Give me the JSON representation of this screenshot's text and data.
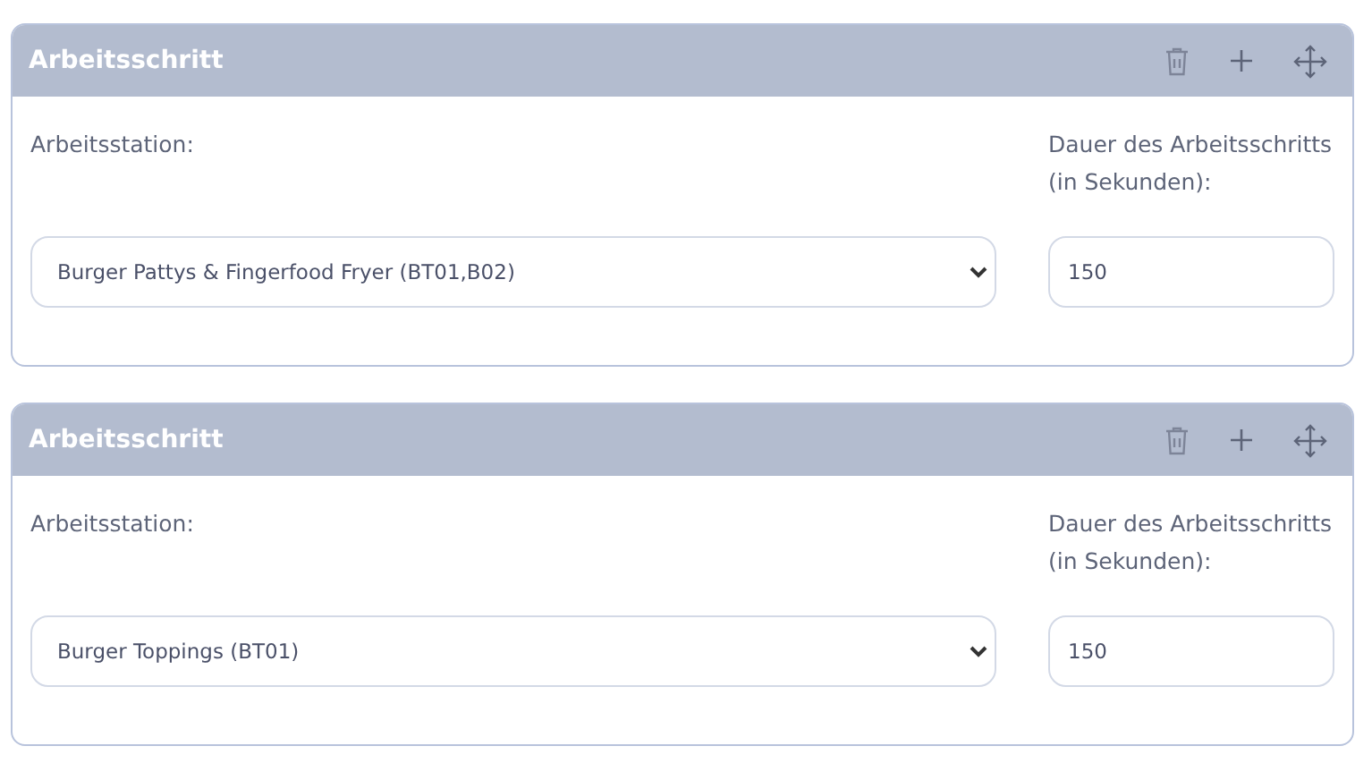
{
  "steps": [
    {
      "title": "Arbeitsschritt",
      "station_label": "Arbeitsstation:",
      "station_value": "Burger Pattys & Fingerfood Fryer (BT01,B02)",
      "duration_label": "Dauer des Arbeitsschritts (in Sekunden):",
      "duration_value": "150"
    },
    {
      "title": "Arbeitsschritt",
      "station_label": "Arbeitsstation:",
      "station_value": "Burger Toppings (BT01)",
      "duration_label": "Dauer des Arbeitsschritts (in Sekunden):",
      "duration_value": "150"
    }
  ]
}
